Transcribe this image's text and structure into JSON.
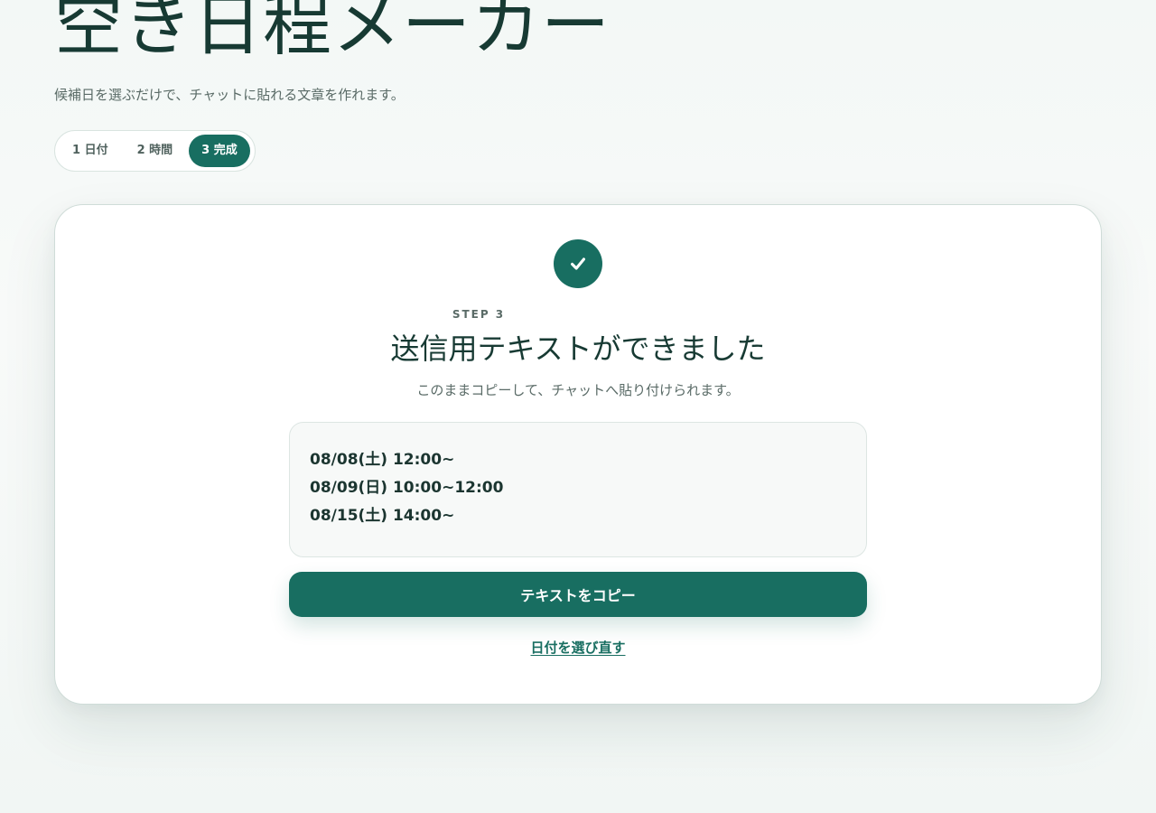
{
  "app": {
    "title": "空き日程メーカー",
    "subtitle": "候補日を選ぶだけで、チャットに貼れる文章を作れます。"
  },
  "stepper": {
    "steps": [
      {
        "label": "1 日付",
        "active": false
      },
      {
        "label": "2 時間",
        "active": false
      },
      {
        "label": "3 完成",
        "active": true
      }
    ]
  },
  "result": {
    "icon": "check-icon",
    "step_label": "STEP 3",
    "title": "送信用テキストができました",
    "description": "このままコピーして、チャットへ貼り付けられます。",
    "lines": [
      "08/08(土) 12:00~",
      "08/09(日) 10:00~12:00",
      "08/15(土) 14:00~"
    ],
    "copy_button_label": "テキストをコピー",
    "reselect_link_label": "日付を選び直す"
  },
  "colors": {
    "accent": "#186e61",
    "text": "#173a33",
    "muted": "#5a6b67"
  }
}
